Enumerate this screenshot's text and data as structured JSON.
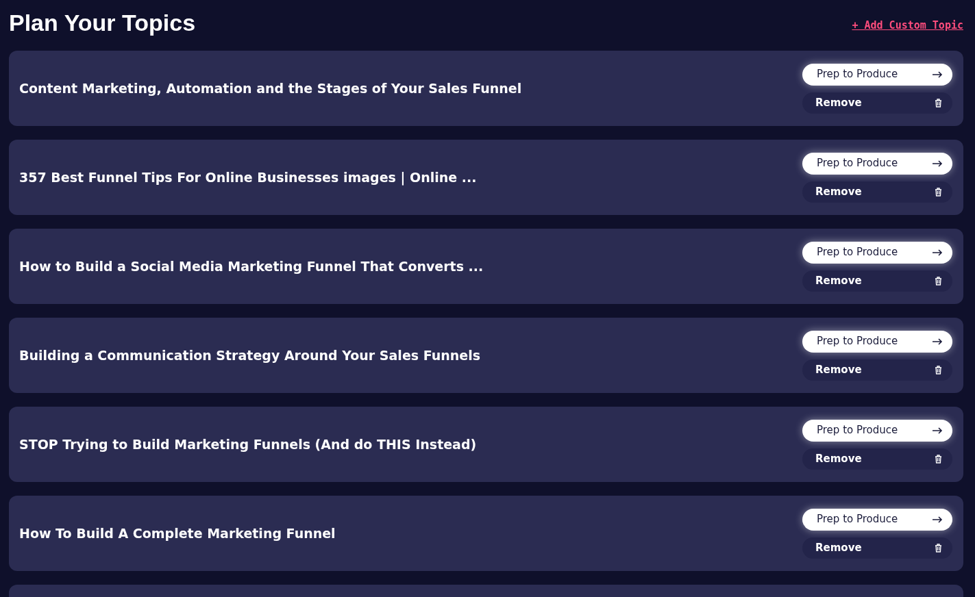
{
  "title": "Plan Your Topics",
  "add_link": "+ Add Custom Topic",
  "topics": [
    {
      "title": "Content Marketing, Automation and the Stages of Your Sales Funnel",
      "primary_button": "Prep to Produce",
      "secondary_button": "Remove"
    },
    {
      "title": "357 Best Funnel Tips For Online Businesses images | Online ...",
      "primary_button": "Prep to Produce",
      "secondary_button": "Remove"
    },
    {
      "title": "How to Build a Social Media Marketing Funnel That Converts ...",
      "primary_button": "Prep to Produce",
      "secondary_button": "Remove"
    },
    {
      "title": "Building a Communication Strategy Around Your Sales Funnels",
      "primary_button": "Prep to Produce",
      "secondary_button": "Remove"
    },
    {
      "title": "STOP Trying to Build Marketing Funnels (And do THIS Instead)",
      "primary_button": "Prep to Produce",
      "secondary_button": "Remove"
    },
    {
      "title": "How To Build A Complete Marketing Funnel",
      "primary_button": "Prep to Produce",
      "secondary_button": "Remove"
    }
  ]
}
